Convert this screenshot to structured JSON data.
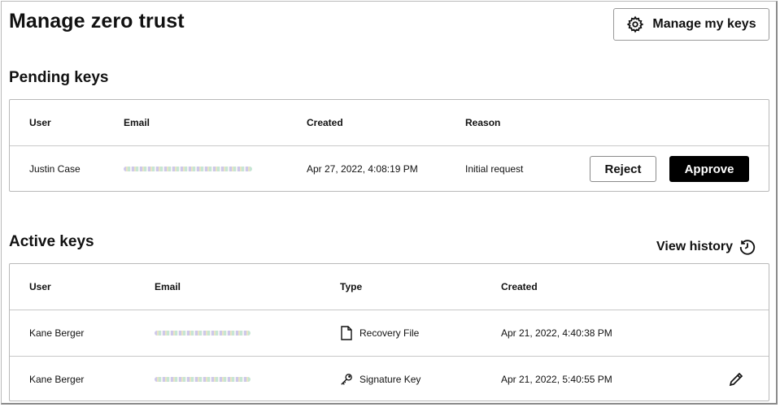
{
  "page": {
    "title": "Manage zero trust"
  },
  "header": {
    "manage_keys_label": "Manage my keys",
    "manage_keys_icon": "gear-icon"
  },
  "pending": {
    "title": "Pending keys",
    "columns": [
      "User",
      "Email",
      "Created",
      "Reason"
    ],
    "rows": [
      {
        "user": "Justin Case",
        "created": "Apr 27, 2022, 4:08:19 PM",
        "reason": "Initial request",
        "reject_label": "Reject",
        "approve_label": "Approve"
      }
    ]
  },
  "active": {
    "title": "Active keys",
    "history_label": "View history",
    "history_icon": "history-clock-icon",
    "columns": [
      "User",
      "Email",
      "Type",
      "Created"
    ],
    "rows": [
      {
        "user": "Kane Berger",
        "type": "Recovery File",
        "type_icon": "file-icon",
        "created": "Apr 21, 2022, 4:40:38 PM"
      },
      {
        "user": "Kane Berger",
        "type": "Signature Key",
        "type_icon": "key-icon",
        "created": "Apr 21, 2022, 5:40:55 PM",
        "action_icon": "pencil-icon"
      }
    ]
  }
}
